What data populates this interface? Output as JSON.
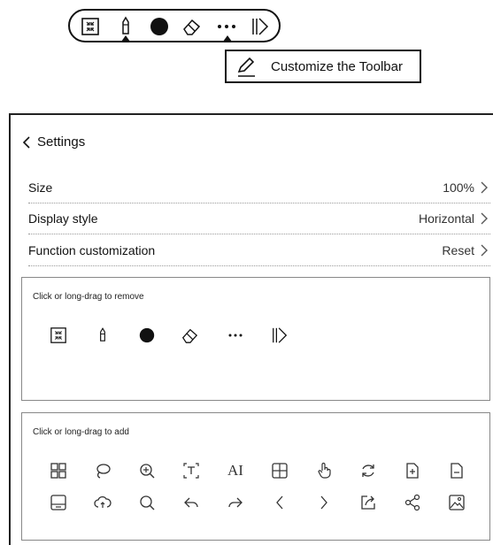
{
  "tooltip": {
    "text": "Customize the Toolbar"
  },
  "settings": {
    "back_label": "Settings",
    "rows": [
      {
        "label": "Size",
        "value": "100%"
      },
      {
        "label": "Display style",
        "value": "Horizontal"
      },
      {
        "label": "Function customization",
        "value": "Reset"
      }
    ]
  },
  "remove_box": {
    "hint": "Click or long-drag to remove"
  },
  "add_box": {
    "hint": "Click or long-drag to add"
  },
  "icons": {
    "toolbar": [
      "collapse-icon",
      "pen-icon",
      "color-dot-icon",
      "eraser-icon",
      "more-icon",
      "expand-icon"
    ],
    "remove": [
      "collapse-icon",
      "pen-icon",
      "color-dot-icon",
      "eraser-icon",
      "more-icon",
      "expand-icon"
    ],
    "add_row1": [
      "layout-grid-icon",
      "lasso-icon",
      "zoom-in-icon",
      "text-box-icon",
      "ai-icon",
      "table-icon",
      "hand-pan-icon",
      "refresh-icon",
      "add-page-icon",
      "page-icon"
    ],
    "add_row2": [
      "save-icon",
      "cloud-sync-icon",
      "search-icon",
      "undo-icon",
      "redo-icon",
      "previous-icon",
      "next-icon",
      "export-icon",
      "share-icon",
      "insert-image-icon"
    ],
    "ai_text": "AI"
  },
  "colors": {
    "ink": "#111111",
    "border": "#888888"
  }
}
